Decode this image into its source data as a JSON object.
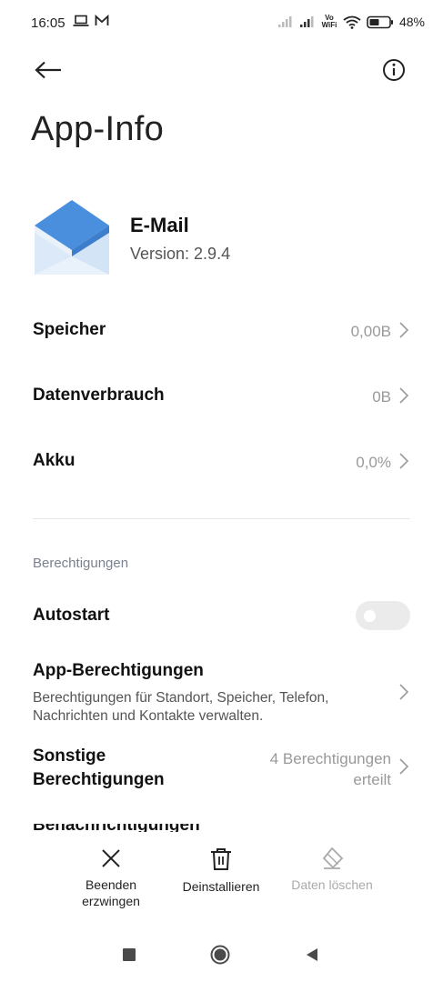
{
  "status_bar": {
    "time": "16:05",
    "signal_label": "Vo WiFi",
    "battery": "48%",
    "notification_icons": [
      "laptop-icon",
      "gmail-icon"
    ],
    "right_icons": [
      "signal-icon",
      "signal-icon",
      "vowifi-icon",
      "wifi-icon",
      "battery-icon"
    ]
  },
  "header": {
    "back_icon": "arrow-left-icon",
    "info_icon": "info-icon",
    "title": "App-Info"
  },
  "app": {
    "name": "E-Mail",
    "version": "Version: 2.9.4",
    "icon": "envelope-icon",
    "icon_colors": {
      "primary": "#4a8fde",
      "secondary": "#cfe3f7"
    }
  },
  "rows": [
    {
      "label": "Speicher",
      "value": "0,00B"
    },
    {
      "label": "Datenverbrauch",
      "value": "0B"
    },
    {
      "label": "Akku",
      "value": "0,0%"
    }
  ],
  "permissions": {
    "section_title": "Berechtigungen",
    "autostart": {
      "label": "Autostart",
      "enabled": false
    },
    "app_permissions": {
      "label": "App-Berechtigungen",
      "description": "Berechtigungen für Standort, Speicher, Telefon, Nachrichten und Kontakte verwalten."
    },
    "other_permissions": {
      "label_line1": "Sonstige",
      "label_line2": "Berechtigungen",
      "value_line1": "4 Berechtigungen",
      "value_line2": "erteilt"
    },
    "next_row_peek": "Benachrichtigungen"
  },
  "actions": [
    {
      "label_line1": "Beenden",
      "label_line2": "erzwingen",
      "icon": "close-icon",
      "enabled": true
    },
    {
      "label_line1": "Deinstallieren",
      "label_line2": "",
      "icon": "trash-icon",
      "enabled": true
    },
    {
      "label_line1": "Daten löschen",
      "label_line2": "",
      "icon": "eraser-icon",
      "enabled": false
    }
  ],
  "nav_bar": {
    "icons": [
      "recents-square-icon",
      "home-circle-icon",
      "back-triangle-icon"
    ]
  }
}
